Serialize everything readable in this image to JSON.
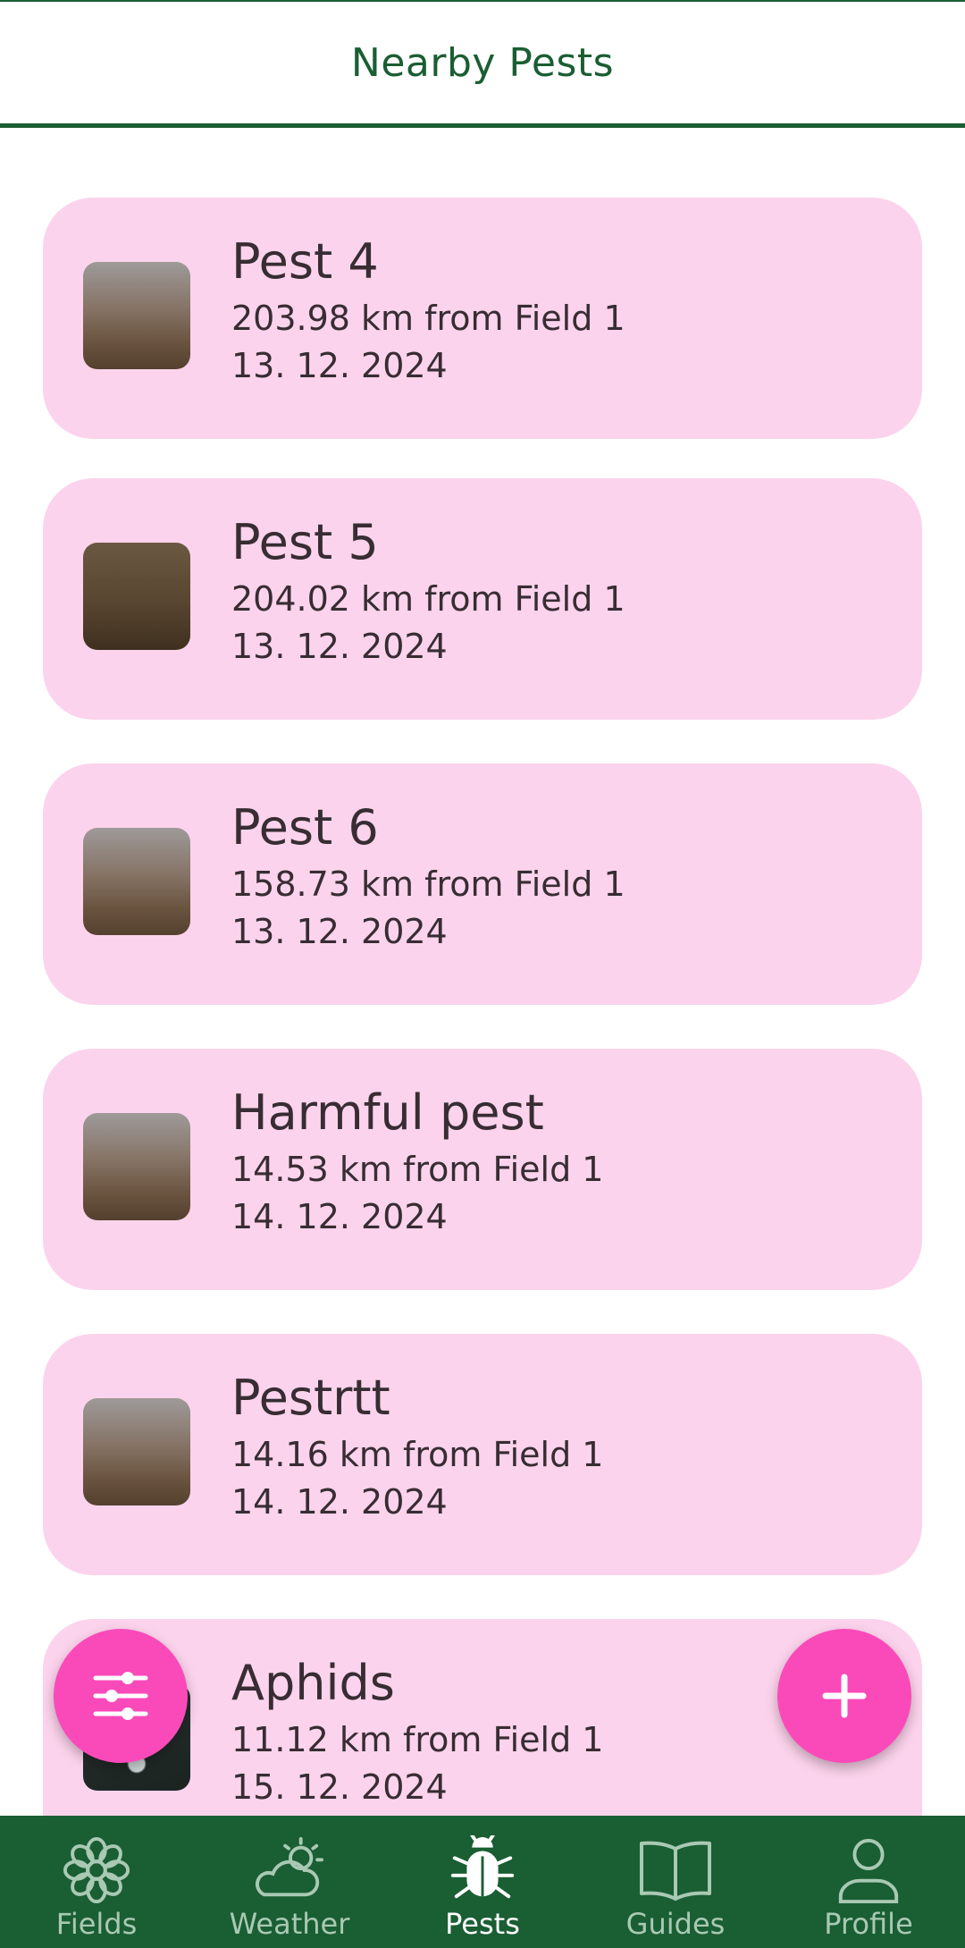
{
  "header": {
    "title": "Nearby Pests"
  },
  "pests": [
    {
      "name": "Pest 4",
      "distance": "203.98 km from Field 1",
      "date": "13. 12. 2024"
    },
    {
      "name": "Pest 5",
      "distance": "204.02 km from Field 1",
      "date": "13. 12. 2024"
    },
    {
      "name": "Pest 6",
      "distance": "158.73 km from Field 1",
      "date": "13. 12. 2024"
    },
    {
      "name": "Harmful pest",
      "distance": "14.53 km from Field 1",
      "date": "14. 12. 2024"
    },
    {
      "name": "Pestrtt",
      "distance": "14.16 km from Field 1",
      "date": "14. 12. 2024"
    },
    {
      "name": "Aphids",
      "distance": "11.12 km from Field 1",
      "date": "15. 12. 2024"
    }
  ],
  "fabs": {
    "filter_icon": "sliders-icon",
    "add_icon": "plus-icon"
  },
  "nav": [
    {
      "label": "Fields",
      "icon": "flower-icon",
      "active": false
    },
    {
      "label": "Weather",
      "icon": "partly-cloudy-icon",
      "active": false
    },
    {
      "label": "Pests",
      "icon": "bug-icon",
      "active": true
    },
    {
      "label": "Guides",
      "icon": "book-icon",
      "active": false
    },
    {
      "label": "Profile",
      "icon": "person-icon",
      "active": false
    }
  ],
  "colors": {
    "primary": "#1a5e33",
    "card": "#fcd3ec",
    "fab": "#fa4aba",
    "nav_inactive": "#a9c9b3",
    "text": "#372d33"
  }
}
